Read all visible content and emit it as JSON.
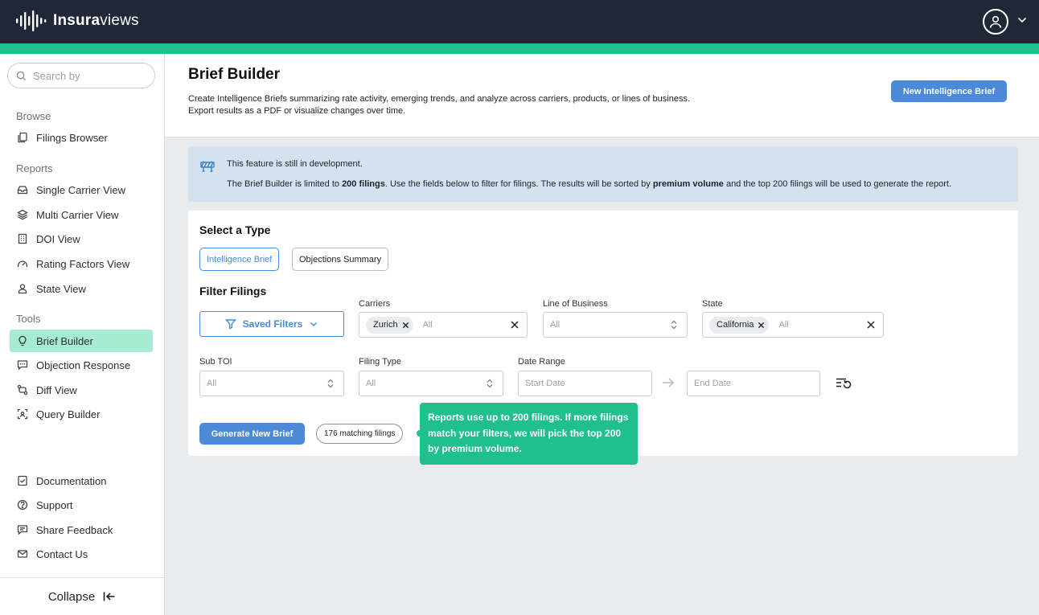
{
  "brand": {
    "name_bold": "Insura",
    "name_light": "views"
  },
  "colors": {
    "topbar": "#202838",
    "accent": "#1fc08e",
    "primary": "#4a8ad9",
    "active_nav": "#a7ecd2",
    "notice_bg": "#d4e1ee"
  },
  "sidebar": {
    "search_placeholder": "Search by",
    "sections": {
      "browse": "Browse",
      "reports": "Reports",
      "tools": "Tools"
    },
    "browse_items": [
      {
        "label": "Filings Browser",
        "icon": "copy-icon"
      }
    ],
    "report_items": [
      {
        "label": "Single Carrier View",
        "icon": "inbox-icon"
      },
      {
        "label": "Multi Carrier View",
        "icon": "layers-icon"
      },
      {
        "label": "DOI View",
        "icon": "building-icon"
      },
      {
        "label": "Rating Factors View",
        "icon": "gauge-icon"
      },
      {
        "label": "State View",
        "icon": "user-pin-icon"
      }
    ],
    "tool_items": [
      {
        "label": "Brief Builder",
        "icon": "lightbulb-icon",
        "active": true
      },
      {
        "label": "Objection Response",
        "icon": "message-icon"
      },
      {
        "label": "Diff View",
        "icon": "diff-icon"
      },
      {
        "label": "Query Builder",
        "icon": "scan-icon"
      }
    ],
    "footer_items": [
      {
        "label": "Documentation",
        "icon": "document-check-icon"
      },
      {
        "label": "Support",
        "icon": "help-circle-icon"
      },
      {
        "label": "Share Feedback",
        "icon": "feedback-icon"
      },
      {
        "label": "Contact Us",
        "icon": "mail-icon"
      }
    ],
    "collapse_label": "Collapse"
  },
  "header": {
    "title": "Brief Builder",
    "description_line1": "Create Intelligence Briefs summarizing rate activity, emerging trends, and analyze across carriers, products, or lines of business.",
    "description_line2": "Export results as a PDF or visualize changes over time.",
    "new_brief_button": "New Intelligence Brief"
  },
  "notice": {
    "line1": "This feature is still in development.",
    "line2_a": "The Brief Builder is limited to ",
    "line2_b": "200 filings",
    "line2_c": ". Use the fields below to filter for filings. The results will be sorted by ",
    "line2_d": "premium volume",
    "line2_e": " and the top 200 filings will be used to generate the report."
  },
  "form": {
    "select_type_heading": "Select a Type",
    "types": [
      {
        "label": "Intelligence Brief",
        "selected": true
      },
      {
        "label": "Objections Summary",
        "selected": false
      }
    ],
    "filter_heading": "Filter Filings",
    "saved_filters": "Saved Filters",
    "carriers": {
      "label": "Carriers",
      "chips": [
        "Zurich"
      ],
      "placeholder": "All"
    },
    "line_of_business": {
      "label": "Line of Business",
      "value": "All"
    },
    "state": {
      "label": "State",
      "chips": [
        "California"
      ],
      "placeholder": "All"
    },
    "sub_toi": {
      "label": "Sub TOI",
      "value": "All"
    },
    "filing_type": {
      "label": "Filing Type",
      "value": "All"
    },
    "date_range": {
      "label": "Date Range",
      "start_placeholder": "Start Date",
      "end_placeholder": "End Date"
    },
    "generate_button": "Generate New Brief",
    "matching_filings": "176 matching filings",
    "tooltip": "Reports use up to 200 filings. If more filings match your filters, we will pick the top 200 by premium volume."
  }
}
